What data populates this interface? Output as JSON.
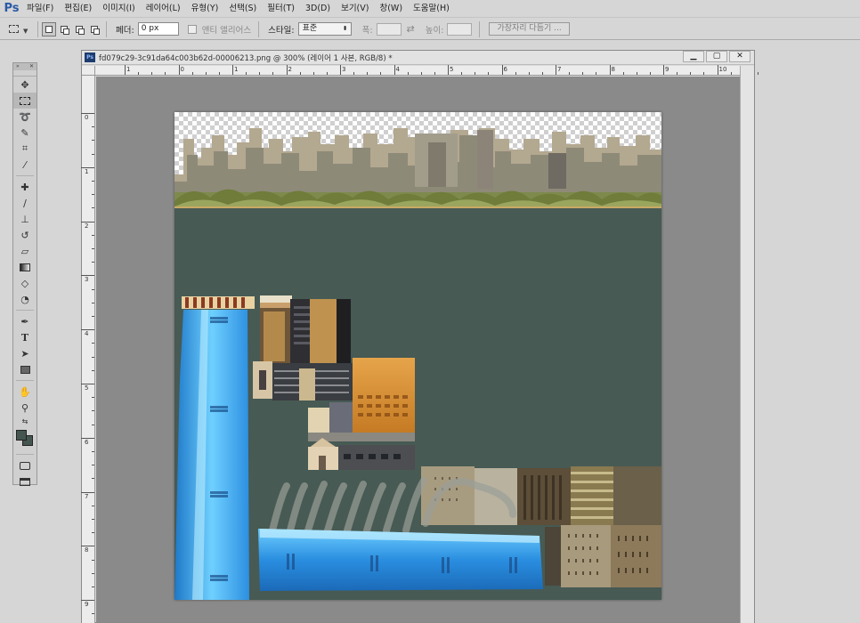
{
  "app": {
    "logo": "Ps"
  },
  "menu": [
    "파일(F)",
    "편집(E)",
    "이미지(I)",
    "레이어(L)",
    "유형(Y)",
    "선택(S)",
    "필터(T)",
    "3D(D)",
    "보기(V)",
    "창(W)",
    "도움말(H)"
  ],
  "options": {
    "feather_label": "페더:",
    "feather_value": "0 px",
    "antialias_label": "앤티 앨리어스",
    "style_label": "스타일:",
    "style_value": "표준",
    "width_label": "폭:",
    "height_label": "높이:",
    "refine_edge": "가장자리 다듬기 ..."
  },
  "document": {
    "title": "fd079c29-3c91da64c003b62d-00006213.png @ 300% (레이어 1 사본, RGB/8) *",
    "ruler_top": [
      "1",
      "0",
      "1",
      "2",
      "3",
      "4",
      "5",
      "6",
      "7",
      "8",
      "9",
      "10"
    ],
    "ruler_left": [
      "0",
      "1",
      "2",
      "3",
      "4",
      "5",
      "6",
      "7",
      "8",
      "9"
    ]
  },
  "window_buttons": {
    "minimize": "▁",
    "restore": "▢",
    "close": "✕"
  },
  "colors": {
    "canvas_bg": "#475a54",
    "foreground": "#44564f",
    "background": "#44564f",
    "accent_blue": "#2a5aa6"
  },
  "tools": [
    "move-icon",
    "marquee-icon",
    "lasso-icon",
    "quick-select-icon",
    "crop-icon",
    "eyedropper-icon",
    "healing-icon",
    "brush-icon",
    "stamp-icon",
    "history-brush-icon",
    "eraser-icon",
    "gradient-icon",
    "blur-icon",
    "dodge-icon",
    "pen-icon",
    "type-icon",
    "path-select-icon",
    "shape-icon",
    "hand-icon",
    "zoom-icon"
  ]
}
